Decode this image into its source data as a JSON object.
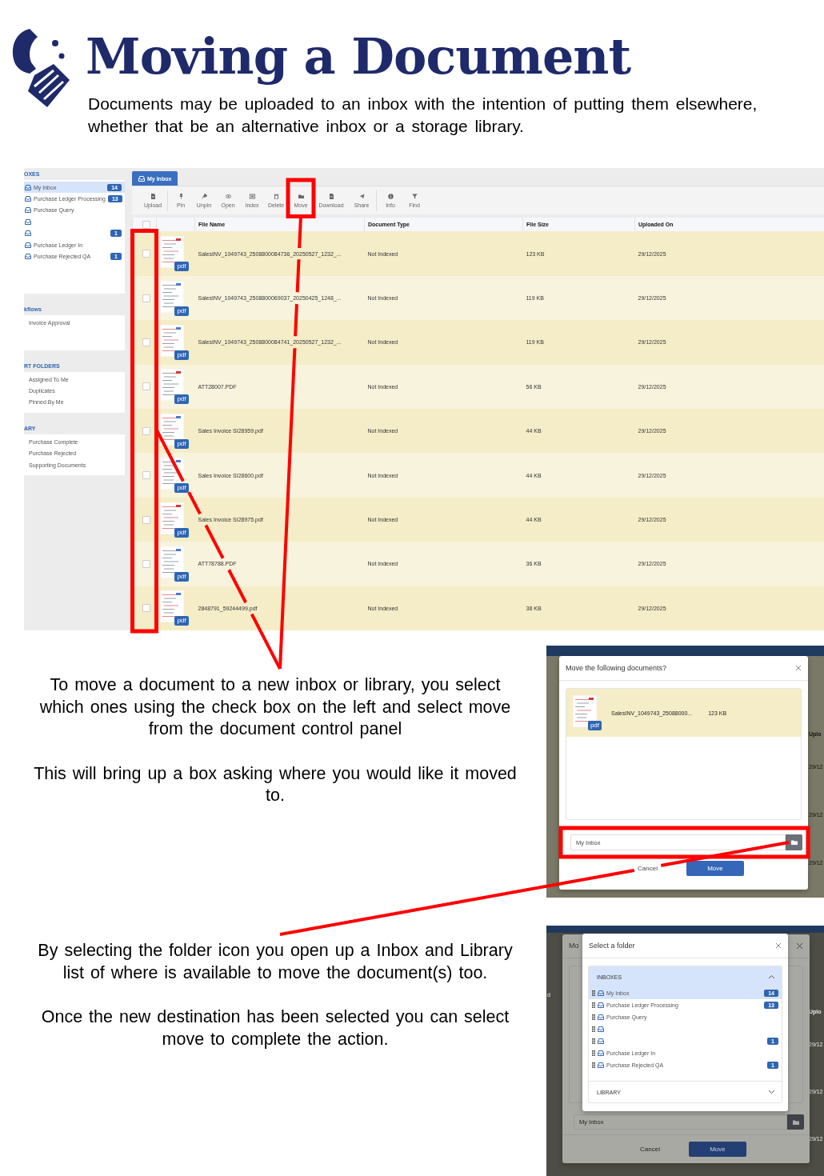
{
  "title": "Moving a Document",
  "intro": "Documents may be uploaded to an inbox with the intention of putting them elsewhere, whether that be an alternative inbox or a storage library.",
  "inbox_screen": {
    "sidebar": [
      {
        "heading": "OXES",
        "items": [
          {
            "label": "My Inbox",
            "badge": "14",
            "selected": true
          },
          {
            "label": "Purchase Ledger Processing",
            "badge": "13",
            "selected": false
          },
          {
            "label": "Purchase Query",
            "selected": false
          },
          {
            "selected": false
          },
          {
            "badge": "1",
            "selected": false
          },
          {
            "label": "Purchase Ledger In",
            "selected": false
          },
          {
            "label": "Purchase Rejected QA",
            "badge": "1",
            "selected": false
          }
        ]
      },
      {
        "heading": "kflows",
        "items": [
          {
            "label": "Invoice Approval",
            "selected": false
          }
        ]
      },
      {
        "heading": "RT FOLDERS",
        "items": [
          {
            "label": "Assigned To Me",
            "selected": false
          },
          {
            "label": "Duplicates",
            "selected": false
          },
          {
            "label": "Pinned By Me",
            "selected": false
          }
        ]
      },
      {
        "heading": "ARY",
        "items": [
          {
            "label": "Purchase Complete",
            "selected": false
          },
          {
            "label": "Purchase Rejected",
            "selected": false
          },
          {
            "label": "Supporting Documents",
            "selected": false
          }
        ]
      }
    ],
    "tab": "My Inbox",
    "select_all": {
      "checked": false
    },
    "toolbar": [
      {
        "label": "Upload"
      },
      {
        "label": "Pin"
      },
      {
        "label": "Unpin"
      },
      {
        "label": "Open"
      },
      {
        "label": "Index"
      },
      {
        "label": "Delete"
      },
      {
        "label": "Move"
      },
      {
        "label": "Download"
      },
      {
        "label": "Share"
      },
      {
        "label": "Info"
      },
      {
        "label": "Find"
      }
    ],
    "columns": [
      "File Name",
      "Document Type",
      "File Size",
      "Uploaded On"
    ],
    "rows": [
      {
        "checked": false,
        "badge": "pdf",
        "file_name": "SalesINV_1049743_2508800084736_20250527_1232_...",
        "document_type": "Not Indexed",
        "file_size": "123 KB",
        "uploaded_on": "29/12/2025"
      },
      {
        "checked": false,
        "badge": "pdf",
        "file_name": "SalesINV_1049743_2508800069037_20250425_1248_...",
        "document_type": "Not Indexed",
        "file_size": "119 KB",
        "uploaded_on": "29/12/2025"
      },
      {
        "checked": false,
        "badge": "pdf",
        "file_name": "SalesINV_1049743_2508800084741_20250527_1232_...",
        "document_type": "Not Indexed",
        "file_size": "119 KB",
        "uploaded_on": "29/12/2025"
      },
      {
        "checked": false,
        "badge": "pdf",
        "file_name": "ATT28007.PDF",
        "document_type": "Not Indexed",
        "file_size": "56 KB",
        "uploaded_on": "29/12/2025"
      },
      {
        "checked": false,
        "badge": "pdf",
        "file_name": "Sales Invoice SI28959.pdf",
        "document_type": "Not Indexed",
        "file_size": "44 KB",
        "uploaded_on": "29/12/2025"
      },
      {
        "checked": false,
        "badge": "pdf",
        "file_name": "Sales Invoice SI28600.pdf",
        "document_type": "Not Indexed",
        "file_size": "44 KB",
        "uploaded_on": "29/12/2025"
      },
      {
        "checked": false,
        "badge": "pdf",
        "file_name": "Sales Invoice SI28975.pdf",
        "document_type": "Not Indexed",
        "file_size": "44 KB",
        "uploaded_on": "29/12/2025"
      },
      {
        "checked": false,
        "badge": "pdf",
        "file_name": "ATT78788.PDF",
        "document_type": "Not Indexed",
        "file_size": "36 KB",
        "uploaded_on": "29/12/2025"
      },
      {
        "checked": false,
        "badge": "pdf",
        "file_name": "2848791_59244499.pdf",
        "document_type": "Not Indexed",
        "file_size": "38 KB",
        "uploaded_on": "29/12/2025"
      }
    ]
  },
  "steps": [
    {
      "paragraphs": [
        "To move a document to a new inbox or library, you select which ones using the check box on the left and select move from the document control panel",
        "This will bring up a box asking where you would like it moved to."
      ]
    },
    {
      "paragraphs": [
        "By selecting the folder icon you open up a Inbox and Library list of where is available to move the document(s) too.",
        "Once the new destination has been selected you can select move to complete the action."
      ]
    }
  ],
  "move_dialog": {
    "title": "Move the following documents?",
    "document": {
      "badge": "pdf",
      "name": "SalesINV_1049743_25088000...",
      "size": "123 KB"
    },
    "destination": "My Inbox",
    "cancel": "Cancel",
    "confirm": "Move",
    "behind": [
      "Uplo",
      "29/12",
      "29/12",
      "29/12"
    ]
  },
  "folder_dialog": {
    "behind_title": "Mo",
    "behind_destination": "My Inbox",
    "behind_cancel": "Cancel",
    "behind_confirm": "Move",
    "behind": [
      "d",
      "Uplo",
      "29/12",
      "29/12",
      "29/12"
    ],
    "title": "Select a folder",
    "sections": [
      {
        "heading": "INBOXES",
        "expanded": true,
        "items": [
          {
            "label": "My Inbox",
            "badge": "14",
            "selected": true
          },
          {
            "label": "Purchase Ledger Processing",
            "badge": "13",
            "selected": false
          },
          {
            "label": "Purchase Query",
            "selected": false
          },
          {
            "selected": false
          },
          {
            "badge": "1",
            "selected": false
          },
          {
            "label": "Purchase Ledger In",
            "selected": false
          },
          {
            "label": "Purchase Rejected QA",
            "badge": "1",
            "selected": false
          }
        ]
      },
      {
        "heading": "LIBRARY",
        "expanded": false
      }
    ]
  }
}
